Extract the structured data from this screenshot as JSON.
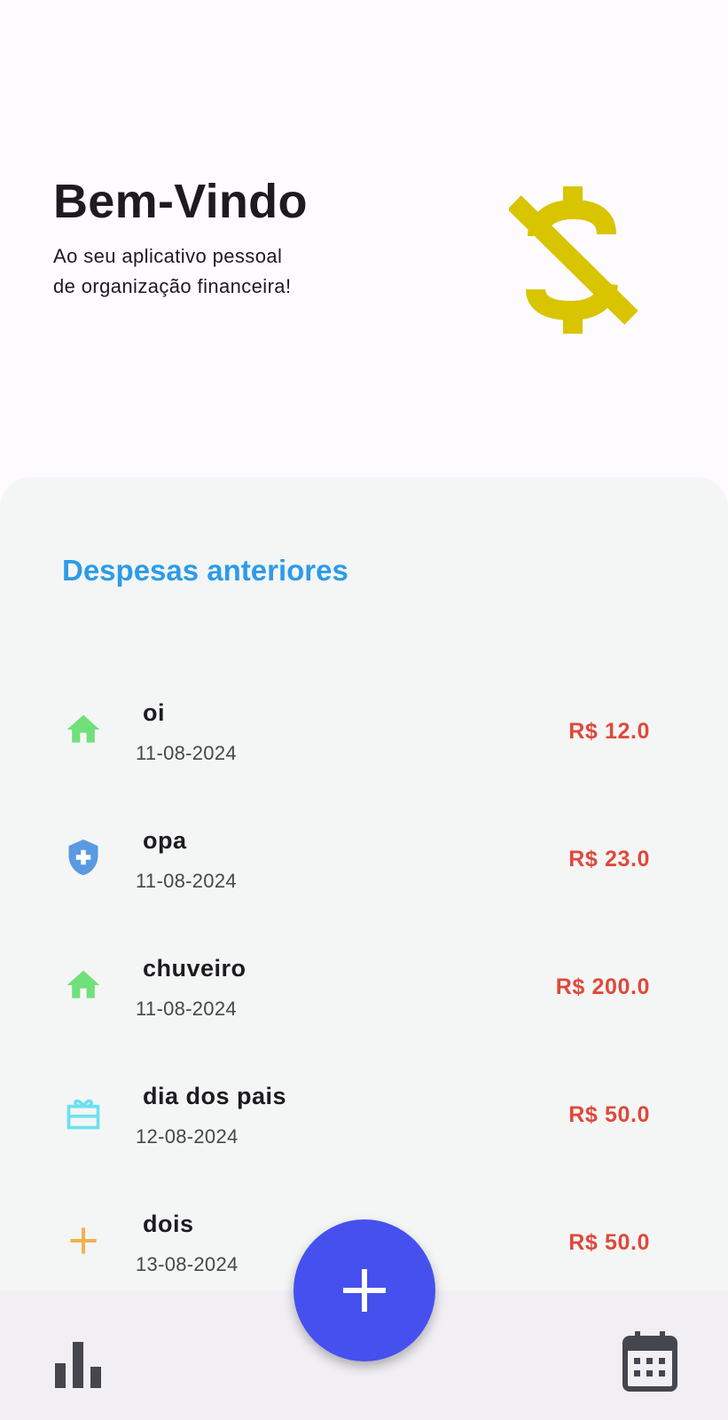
{
  "header": {
    "title": "Bem-Vindo",
    "subtitle_line1": "Ao seu aplicativo pessoal",
    "subtitle_line2": "de organização financeira!",
    "icon": "money-off-icon",
    "icon_color": "#d9c400"
  },
  "expenses": {
    "title": "Despesas anteriores",
    "title_color": "#2d9be8",
    "amount_color": "#e0483b",
    "items": [
      {
        "name": "oi",
        "date": "11-08-2024",
        "amount": "R$ 12.0",
        "icon": "home-icon",
        "icon_color": "#6fe07a"
      },
      {
        "name": "opa",
        "date": "11-08-2024",
        "amount": "R$ 23.0",
        "icon": "health-shield-icon",
        "icon_color": "#5a9ae0"
      },
      {
        "name": "chuveiro",
        "date": "11-08-2024",
        "amount": "R$ 200.0",
        "icon": "home-icon",
        "icon_color": "#6fe07a"
      },
      {
        "name": "dia dos pais",
        "date": "12-08-2024",
        "amount": "R$ 50.0",
        "icon": "gift-icon",
        "icon_color": "#6ee0ef"
      },
      {
        "name": "dois",
        "date": "13-08-2024",
        "amount": "R$ 50.0",
        "icon": "plus-icon",
        "icon_color": "#f0b250"
      }
    ]
  },
  "bottom_nav": {
    "left_icon": "bar-chart-icon",
    "fab_icon": "add-icon",
    "fab_color": "#4650ee",
    "right_icon": "calendar-icon"
  }
}
